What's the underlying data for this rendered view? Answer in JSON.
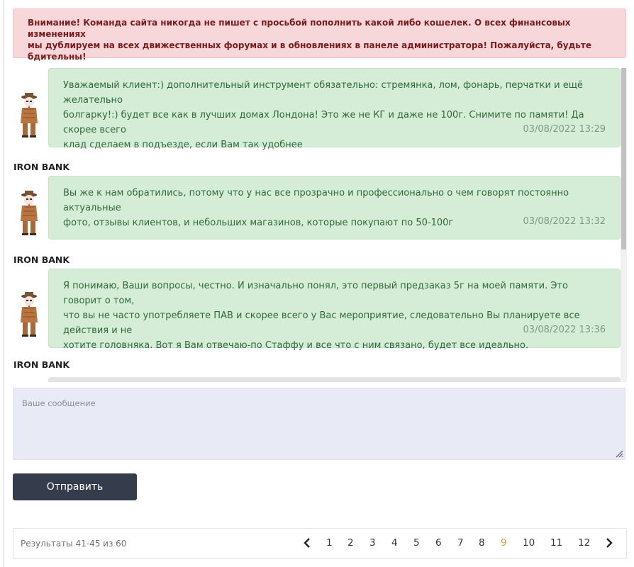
{
  "warning": {
    "line1": "Внимание! Команда сайта никогда не пишет с просьбой пополнить какой либо кошелек. О всех финансовых изменениях",
    "line2": "мы дублируем на всех движественных форумах и в обновлениях в панеле администратора! Пожалуйста, будьте",
    "line3": "бдительны!"
  },
  "messages": [
    {
      "lines": [
        "Уважаемый клиент:) дополнительный инструмент обязательно: стремянка, лом, фонарь, перчатки и ещё желательно",
        "болгарку!:) будет все как в лучших домах Лондона! Это же не КГ и даже не 100г. Снимите по памяти! Да скорее всего",
        "клад сделаем в подъезде, если Вам так удобнее"
      ],
      "time": "03/08/2022 13:29",
      "author": "IRON BANK"
    },
    {
      "lines": [
        "Вы же к нам обратились, потому что у нас все прозрачно и профессионально о чем говорят постоянно актуальные",
        "фото, отзывы клиентов, и небольших магазинов, которые покупают по 50-100г"
      ],
      "time": "03/08/2022 13:32",
      "author": "IRON BANK"
    },
    {
      "lines": [
        "Я понимаю, Ваши вопросы, честно. И изначально понял, это первый предзаказ 5г на моей памяти. Это говорит о том,",
        "что вы не часто употребляете ПАВ и скорее всего у Вас мероприятие, следовательно Вы планируете все действия и не",
        "хотите головняка. Вот я Вам отвечаю-по Стаффу и все что с ним связано, будет все идеально."
      ],
      "time": "03/08/2022 13:36",
      "author": "IRON BANK"
    }
  ],
  "composer": {
    "placeholder": "Ваше сообщение",
    "send_label": "Отправить"
  },
  "pagination": {
    "results": "Результаты 41-45 из 60",
    "pages": [
      "1",
      "2",
      "3",
      "4",
      "5",
      "6",
      "7",
      "8",
      "9",
      "10",
      "11",
      "12"
    ],
    "active": "9",
    "prev_icon": "chevron-left-icon",
    "next_icon": "chevron-right-icon"
  },
  "colors": {
    "warning_bg": "#f8d7da",
    "bubble_bg": "#d5ecd6",
    "input_bg": "#e8eaf6",
    "button_bg": "#353d4d",
    "active_page": "#e4973a"
  }
}
